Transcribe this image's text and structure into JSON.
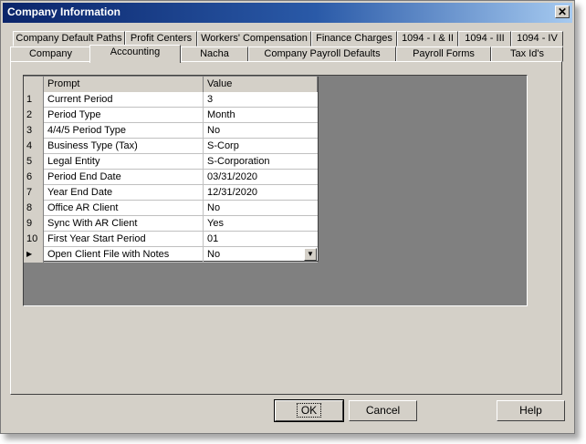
{
  "window": {
    "title": "Company Information",
    "close_label": "✕"
  },
  "tabs_top": [
    "Company Default Paths",
    "Profit Centers",
    "Workers' Compensation",
    "Finance Charges",
    "1094 - I & II",
    "1094 - III",
    "1094 - IV"
  ],
  "tabs_bottom": [
    "Company",
    "Accounting",
    "Nacha",
    "Company Payroll Defaults",
    "Payroll Forms",
    "Tax Id's"
  ],
  "active_tab": "Accounting",
  "grid": {
    "headers": {
      "prompt": "Prompt",
      "value": "Value"
    },
    "rows": [
      {
        "num": "1",
        "prompt": "Current Period",
        "value": "3"
      },
      {
        "num": "2",
        "prompt": "Period Type",
        "value": "Month"
      },
      {
        "num": "3",
        "prompt": "4/4/5 Period Type",
        "value": "No"
      },
      {
        "num": "4",
        "prompt": "Business Type (Tax)",
        "value": "S-Corp"
      },
      {
        "num": "5",
        "prompt": "Legal Entity",
        "value": "S-Corporation"
      },
      {
        "num": "6",
        "prompt": "Period End Date",
        "value": "03/31/2020"
      },
      {
        "num": "7",
        "prompt": "Year End Date",
        "value": "12/31/2020"
      },
      {
        "num": "8",
        "prompt": "Office AR Client",
        "value": "No"
      },
      {
        "num": "9",
        "prompt": "Sync With AR Client",
        "value": "Yes"
      },
      {
        "num": "10",
        "prompt": "First Year Start Period",
        "value": "01"
      },
      {
        "num": "▶",
        "prompt": "Open Client File with Notes",
        "value": "No",
        "current": true
      }
    ]
  },
  "buttons": {
    "ok": "OK",
    "cancel": "Cancel",
    "help": "Help"
  }
}
